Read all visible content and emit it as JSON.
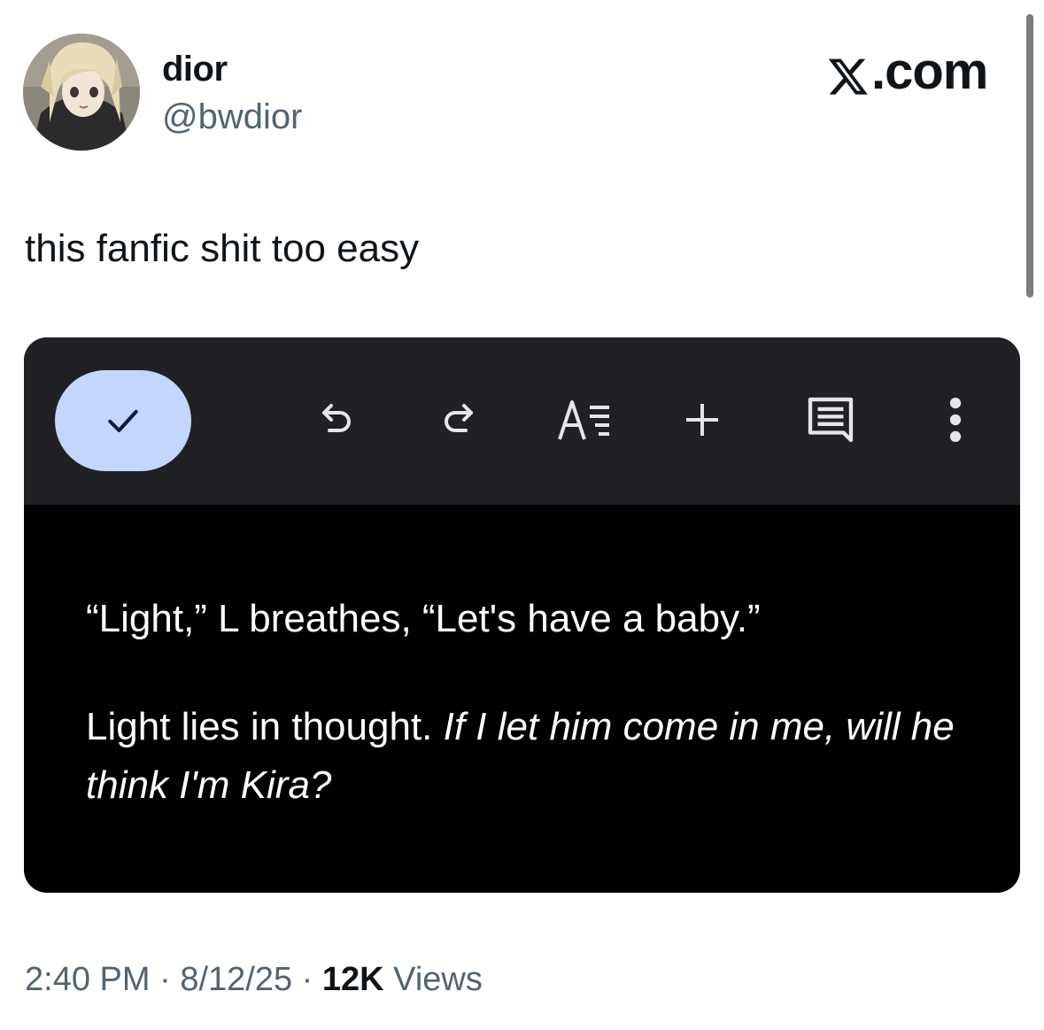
{
  "author": {
    "display_name": "dior",
    "handle": "@bwdior"
  },
  "brand": {
    "label": ".com",
    "logo_icon": "x-logo-icon"
  },
  "tweet": {
    "text": "this fanfic shit too easy"
  },
  "editor": {
    "toolbar": {
      "done_icon": "checkmark-icon",
      "undo_icon": "undo-icon",
      "redo_icon": "redo-icon",
      "format_icon": "text-format-icon",
      "insert_icon": "plus-icon",
      "comment_icon": "comment-icon",
      "more_icon": "more-vertical-icon"
    },
    "paragraph_1": "“Light,” L breathes, “Let's have a baby.”",
    "paragraph_2_plain": "Light lies in thought.",
    "paragraph_2_italic": "If I let him come in me, will he think I'm Kira?"
  },
  "meta": {
    "time": "2:40 PM",
    "separator": "·",
    "date": "8/12/25",
    "views_count": "12K",
    "views_label": "Views"
  },
  "colors": {
    "toolbar_bg": "#202125",
    "done_button_bg": "#c2d7fb",
    "secondary_text": "#536471"
  }
}
